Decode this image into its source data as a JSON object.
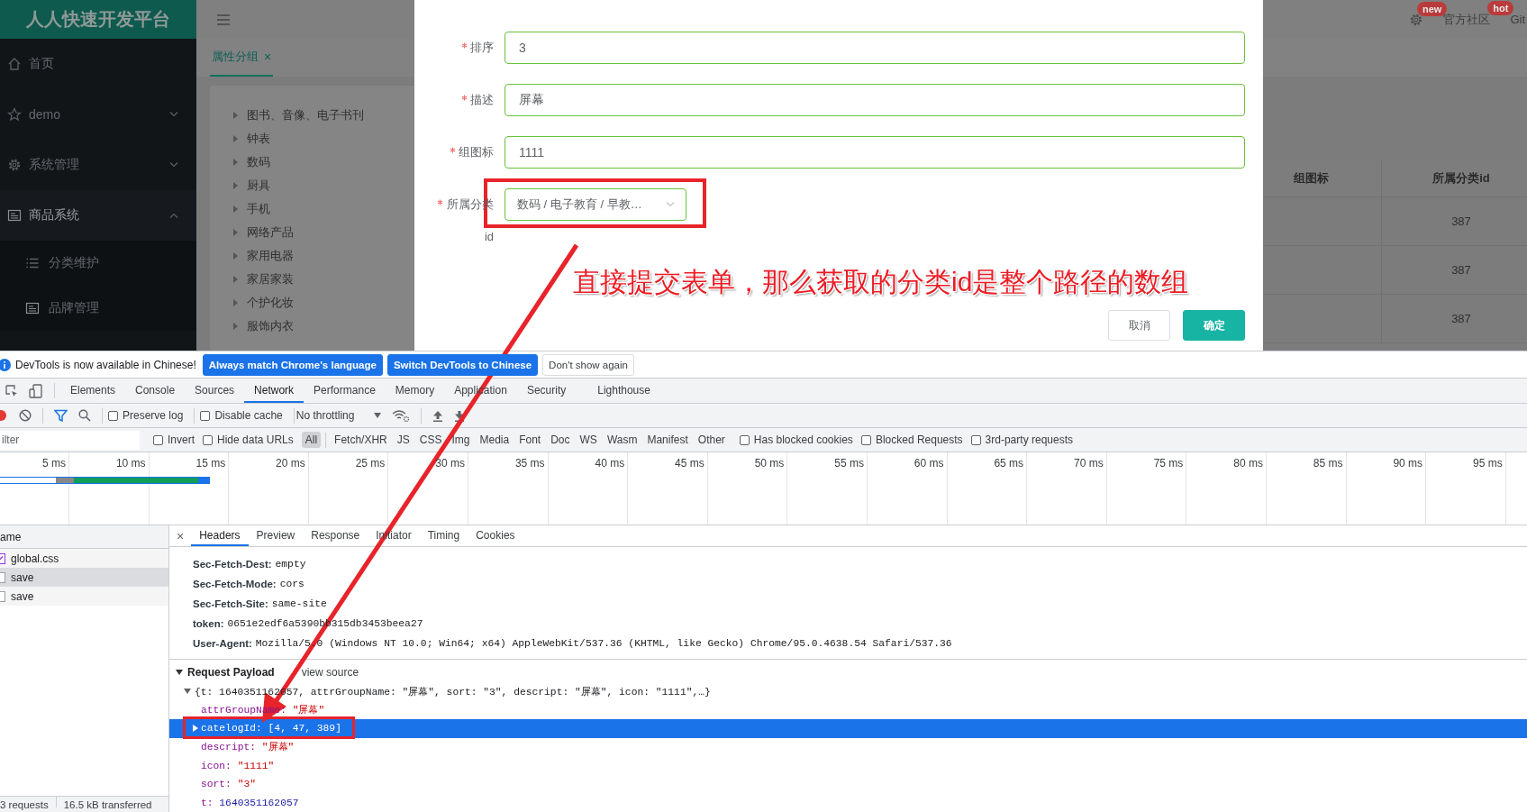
{
  "app": {
    "logo": "人人快速开发平台",
    "sidebar": [
      {
        "label": "首页"
      },
      {
        "label": "demo",
        "expanded": false
      },
      {
        "label": "系统管理",
        "expanded": false
      },
      {
        "label": "商品系统",
        "expanded": true,
        "children": [
          {
            "label": "分类维护"
          },
          {
            "label": "品牌管理"
          }
        ]
      }
    ],
    "header_items": [
      {
        "kind": "gear",
        "badge": "new"
      },
      {
        "kind": "text",
        "label": "官方社区",
        "badge": "hot"
      },
      {
        "kind": "text",
        "label": "Git"
      }
    ],
    "tabs": [
      {
        "label": "属性分组",
        "close": "×",
        "selected": true
      }
    ],
    "tree": [
      "图书、音像、电子书刊",
      "钟表",
      "数码",
      "厨具",
      "手机",
      "网络产品",
      "家用电器",
      "家居家装",
      "个护化妆",
      "服饰内衣"
    ],
    "table": {
      "columns": [
        "组图标",
        "所属分类id"
      ],
      "rows": [
        {
          "catalog_id": "387"
        },
        {
          "catalog_id": "387"
        },
        {
          "catalog_id": "387"
        }
      ]
    }
  },
  "dialog": {
    "fields": [
      {
        "label": "排序",
        "required": true,
        "kind": "input",
        "value": "3"
      },
      {
        "label": "描述",
        "required": true,
        "kind": "input",
        "value": "屏幕"
      },
      {
        "label": "组图标",
        "required": true,
        "kind": "input",
        "value": "1111"
      },
      {
        "label": "所属分类id",
        "required": true,
        "kind": "cascader",
        "value": "数码 / 电子教育 / 早教…"
      }
    ],
    "buttons": [
      {
        "label": "取消",
        "kind": "default"
      },
      {
        "label": "确定",
        "kind": "primary"
      }
    ]
  },
  "annotation": {
    "text": "直接提交表单，那么获取的分类id是整个路径的数组"
  },
  "devtools": {
    "infobar": {
      "message": "DevTools is now available in Chinese!",
      "buttons": [
        {
          "label": "Always match Chrome's language",
          "kind": "primary"
        },
        {
          "label": "Switch DevTools to Chinese",
          "kind": "primary"
        },
        {
          "label": "Don't show again",
          "kind": "default"
        }
      ]
    },
    "tabs": [
      {
        "label": "Elements",
        "selected": false
      },
      {
        "label": "Console",
        "selected": false
      },
      {
        "label": "Sources",
        "selected": false
      },
      {
        "label": "Network",
        "selected": true
      },
      {
        "label": "Performance",
        "selected": false
      },
      {
        "label": "Memory",
        "selected": false
      },
      {
        "label": "Application",
        "selected": false
      },
      {
        "label": "Security",
        "selected": false
      },
      {
        "label": "Lighthouse",
        "selected": false
      }
    ],
    "toolbar": {
      "recording": true,
      "checkboxes": [
        {
          "label": "Preserve log",
          "checked": false
        },
        {
          "label": "Disable cache",
          "checked": false
        }
      ],
      "throttling": "No throttling"
    },
    "filter_bar": {
      "placeholder": "ilter",
      "options": [
        {
          "label": "Invert",
          "checked": false
        },
        {
          "label": "Hide data URLs",
          "checked": false
        }
      ],
      "types": [
        {
          "label": "All",
          "selected": true
        },
        {
          "label": "Fetch/XHR",
          "selected": false
        },
        {
          "label": "JS",
          "selected": false
        },
        {
          "label": "CSS",
          "selected": false
        },
        {
          "label": "Img",
          "selected": false
        },
        {
          "label": "Media",
          "selected": false
        },
        {
          "label": "Font",
          "selected": false
        },
        {
          "label": "Doc",
          "selected": false
        },
        {
          "label": "WS",
          "selected": false
        },
        {
          "label": "Wasm",
          "selected": false
        },
        {
          "label": "Manifest",
          "selected": false
        },
        {
          "label": "Other",
          "selected": false
        }
      ],
      "more_options": [
        {
          "label": "Has blocked cookies",
          "checked": false
        },
        {
          "label": "Blocked Requests",
          "checked": false
        },
        {
          "label": "3rd-party requests",
          "checked": false
        }
      ]
    },
    "timeline_ticks": [
      "5 ms",
      "10 ms",
      "15 ms",
      "20 ms",
      "25 ms",
      "30 ms",
      "35 ms",
      "40 ms",
      "45 ms",
      "50 ms",
      "55 ms",
      "60 ms",
      "65 ms",
      "70 ms",
      "75 ms",
      "80 ms",
      "85 ms",
      "90 ms",
      "95 ms"
    ],
    "requests": {
      "column": "ame",
      "rows": [
        {
          "name": "global.css",
          "kind": "css",
          "selected": false
        },
        {
          "name": "save",
          "kind": "xhr",
          "selected": true
        },
        {
          "name": "save",
          "kind": "xhr",
          "selected": false
        }
      ],
      "footer": [
        "3 requests",
        "16.5 kB transferred"
      ]
    },
    "detail_tabs": {
      "close": "×",
      "tabs": [
        {
          "label": "Headers",
          "selected": true
        },
        {
          "label": "Preview",
          "selected": false
        },
        {
          "label": "Response",
          "selected": false
        },
        {
          "label": "Initiator",
          "selected": false
        },
        {
          "label": "Timing",
          "selected": false
        },
        {
          "label": "Cookies",
          "selected": false
        }
      ]
    },
    "headers": [
      {
        "name": "Sec-Fetch-Dest:",
        "value": "empty"
      },
      {
        "name": "Sec-Fetch-Mode:",
        "value": "cors"
      },
      {
        "name": "Sec-Fetch-Site:",
        "value": "same-site"
      },
      {
        "name": "token:",
        "value": "0651e2edf6a5390bb315db3453beea27"
      },
      {
        "name": "User-Agent:",
        "value": "Mozilla/5.0 (Windows NT 10.0; Win64; x64) AppleWebKit/537.36 (KHTML, like Gecko) Chrome/95.0.4638.54 Safari/537.36"
      }
    ],
    "payload": {
      "title": "Request Payload",
      "expanded": true,
      "link": "view source",
      "summary": "{t: 1640351162057, attrGroupName: \"屏幕\", sort: \"3\", descript: \"屏幕\", icon: \"1111\",…}",
      "entries": [
        {
          "key": "attrGroupName:",
          "value": "\"屏幕\"",
          "kind": "string",
          "selected": false
        },
        {
          "key": "catelogId:",
          "value": "[4, 47, 389]",
          "kind": "array",
          "selected": true
        },
        {
          "key": "descript:",
          "value": "\"屏幕\"",
          "kind": "string",
          "selected": false
        },
        {
          "key": "icon:",
          "value": "\"1111\"",
          "kind": "string",
          "selected": false
        },
        {
          "key": "sort:",
          "value": "\"3\"",
          "kind": "string",
          "selected": false
        },
        {
          "key": "t:",
          "value": "1640351162057",
          "kind": "number",
          "selected": false
        }
      ]
    }
  }
}
